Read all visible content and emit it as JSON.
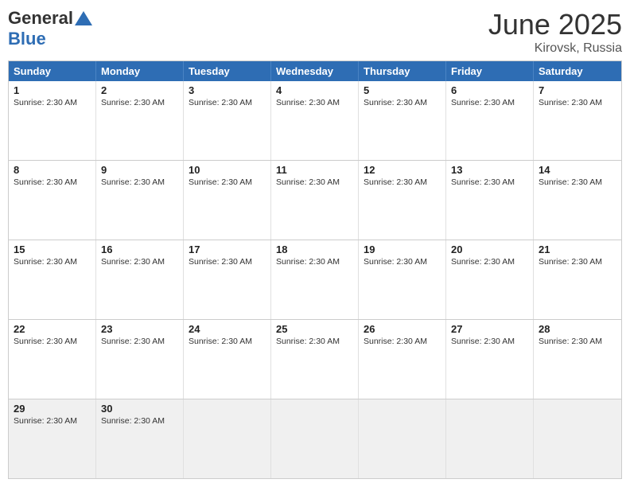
{
  "logo": {
    "general": "General",
    "blue": "Blue"
  },
  "title": {
    "month_year": "June 2025",
    "location": "Kirovsk, Russia"
  },
  "header_days": [
    "Sunday",
    "Monday",
    "Tuesday",
    "Wednesday",
    "Thursday",
    "Friday",
    "Saturday"
  ],
  "weeks": [
    [
      {
        "day": "1",
        "sunrise": "Sunrise: 2:30 AM",
        "empty": false
      },
      {
        "day": "2",
        "sunrise": "Sunrise: 2:30 AM",
        "empty": false
      },
      {
        "day": "3",
        "sunrise": "Sunrise: 2:30 AM",
        "empty": false
      },
      {
        "day": "4",
        "sunrise": "Sunrise: 2:30 AM",
        "empty": false
      },
      {
        "day": "5",
        "sunrise": "Sunrise: 2:30 AM",
        "empty": false
      },
      {
        "day": "6",
        "sunrise": "Sunrise: 2:30 AM",
        "empty": false
      },
      {
        "day": "7",
        "sunrise": "Sunrise: 2:30 AM",
        "empty": false
      }
    ],
    [
      {
        "day": "8",
        "sunrise": "Sunrise: 2:30 AM",
        "empty": false
      },
      {
        "day": "9",
        "sunrise": "Sunrise: 2:30 AM",
        "empty": false
      },
      {
        "day": "10",
        "sunrise": "Sunrise: 2:30 AM",
        "empty": false
      },
      {
        "day": "11",
        "sunrise": "Sunrise: 2:30 AM",
        "empty": false
      },
      {
        "day": "12",
        "sunrise": "Sunrise: 2:30 AM",
        "empty": false
      },
      {
        "day": "13",
        "sunrise": "Sunrise: 2:30 AM",
        "empty": false
      },
      {
        "day": "14",
        "sunrise": "Sunrise: 2:30 AM",
        "empty": false
      }
    ],
    [
      {
        "day": "15",
        "sunrise": "Sunrise: 2:30 AM",
        "empty": false
      },
      {
        "day": "16",
        "sunrise": "Sunrise: 2:30 AM",
        "empty": false
      },
      {
        "day": "17",
        "sunrise": "Sunrise: 2:30 AM",
        "empty": false
      },
      {
        "day": "18",
        "sunrise": "Sunrise: 2:30 AM",
        "empty": false
      },
      {
        "day": "19",
        "sunrise": "Sunrise: 2:30 AM",
        "empty": false
      },
      {
        "day": "20",
        "sunrise": "Sunrise: 2:30 AM",
        "empty": false
      },
      {
        "day": "21",
        "sunrise": "Sunrise: 2:30 AM",
        "empty": false
      }
    ],
    [
      {
        "day": "22",
        "sunrise": "Sunrise: 2:30 AM",
        "empty": false
      },
      {
        "day": "23",
        "sunrise": "Sunrise: 2:30 AM",
        "empty": false
      },
      {
        "day": "24",
        "sunrise": "Sunrise: 2:30 AM",
        "empty": false
      },
      {
        "day": "25",
        "sunrise": "Sunrise: 2:30 AM",
        "empty": false
      },
      {
        "day": "26",
        "sunrise": "Sunrise: 2:30 AM",
        "empty": false
      },
      {
        "day": "27",
        "sunrise": "Sunrise: 2:30 AM",
        "empty": false
      },
      {
        "day": "28",
        "sunrise": "Sunrise: 2:30 AM",
        "empty": false
      }
    ],
    [
      {
        "day": "29",
        "sunrise": "Sunrise: 2:30 AM",
        "empty": false
      },
      {
        "day": "30",
        "sunrise": "Sunrise: 2:30 AM",
        "empty": false
      },
      {
        "day": "",
        "sunrise": "",
        "empty": true
      },
      {
        "day": "",
        "sunrise": "",
        "empty": true
      },
      {
        "day": "",
        "sunrise": "",
        "empty": true
      },
      {
        "day": "",
        "sunrise": "",
        "empty": true
      },
      {
        "day": "",
        "sunrise": "",
        "empty": true
      }
    ]
  ]
}
